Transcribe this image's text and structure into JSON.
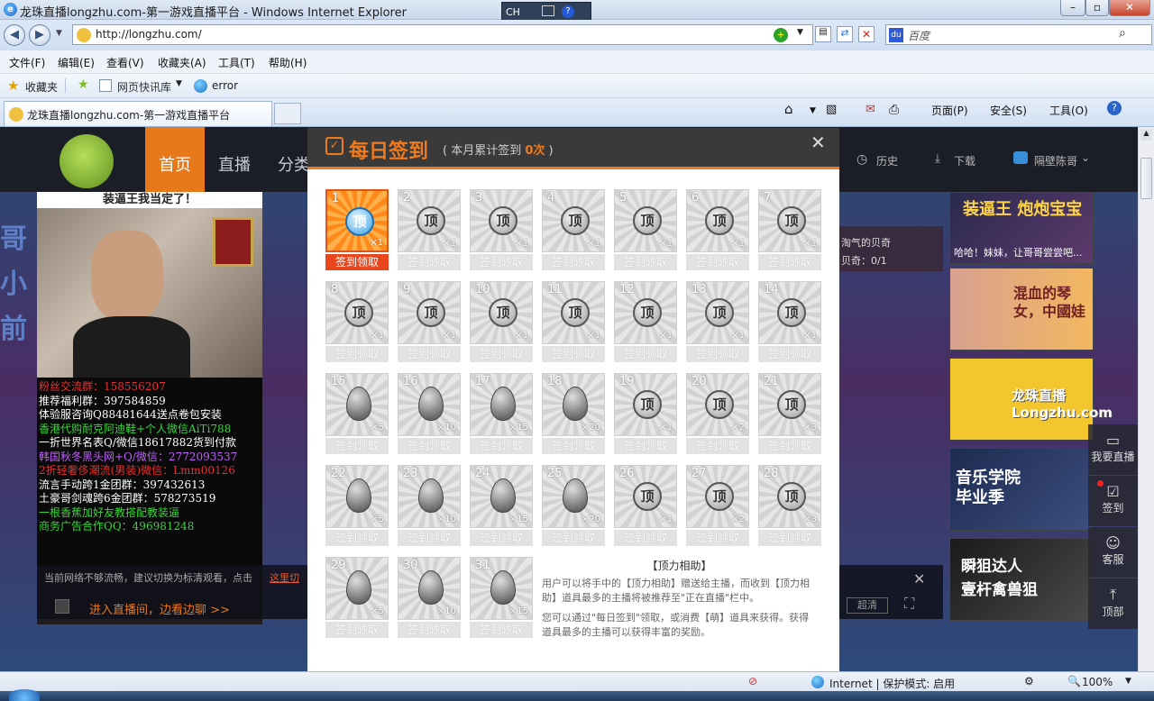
{
  "window": {
    "title": "龙珠直播longzhu.com-第一游戏直播平台 - Windows Internet Explorer",
    "lang_indicator": "CH"
  },
  "address": {
    "url": "http://longzhu.com/",
    "search_placeholder": "百度"
  },
  "menu": [
    "文件(F)",
    "编辑(E)",
    "查看(V)",
    "收藏夹(A)",
    "工具(T)",
    "帮助(H)"
  ],
  "favorites": {
    "label": "收藏夹",
    "item1": "网页快讯库",
    "item2": "error"
  },
  "tab": {
    "label": "龙珠直播longzhu.com-第一游戏直播平台"
  },
  "command_bar": {
    "page": "页面(P)",
    "safety": "安全(S)",
    "tools": "工具(O)"
  },
  "site": {
    "nav": [
      "首页",
      "直播",
      "分类"
    ],
    "history": "历史",
    "download": "下载",
    "user": "隔壁陈哥",
    "video_banner": "装逼王我当定了！",
    "chat_lines": [
      {
        "text": "粉丝交流群：158556207",
        "color": "#e83030"
      },
      {
        "text": "推荐福利群：397584859",
        "color": "#ffffff"
      },
      {
        "text": "体验服咨询Q88481644送点卷包安装",
        "color": "#ffffff"
      },
      {
        "text": "香港代购耐克阿迪鞋+个人微信AiTi788",
        "color": "#3ad43a"
      },
      {
        "text": "一折世界名表Q/微信18617882货到付款",
        "color": "#ffffff"
      },
      {
        "text": "韩国秋冬黑头网+Q/微信：2772093537",
        "color": "#c060ff"
      },
      {
        "text": "2折轻奢侈潮流(男装)微信：Lmm00126",
        "color": "#e83030"
      },
      {
        "text": "流言手动跨1金团群：397432613",
        "color": "#ffffff"
      },
      {
        "text": "土豪哥剑魂跨6金团群：578273519",
        "color": "#ffffff"
      },
      {
        "text": "一根香蕉加好友教搭配教装逼",
        "color": "#3ad43a"
      },
      {
        "text": "商务广告合作QQ：496981248",
        "color": "#3ad43a"
      }
    ],
    "network_tip": "当前网络不够流畅，建议切换为标清观看，点击",
    "network_link": "这里切",
    "enter_room": "进入直播间，边看边聊 >>",
    "clear_btn": "超清",
    "quest_text": "淘气的贝奇",
    "quest_progress": "贝奇：0/1",
    "side_buttons": [
      "我要直播",
      "签到",
      "客服",
      "顶部"
    ],
    "promos": [
      {
        "title": "装逼王 炮炮宝宝",
        "caption": "哈哈！妹妹，让哥哥尝尝吧..."
      },
      {
        "title": "混血的琴女，中國娃",
        "caption": ""
      },
      {
        "title": "龙珠直播 Longzhu.com",
        "caption": ""
      },
      {
        "title": "音乐学院毕业季",
        "caption": ""
      },
      {
        "title": "瞬狙达人 壹杆禽兽狙",
        "caption": ""
      }
    ]
  },
  "modal": {
    "title": "每日签到",
    "sub_prefix": "( 本月累计签到 ",
    "sub_count": "0次",
    "sub_suffix": " )",
    "claim_label": "签到领取",
    "days": [
      {
        "n": "1",
        "type": "ding",
        "qty": "×1"
      },
      {
        "n": "2",
        "type": "ding",
        "qty": "×1"
      },
      {
        "n": "3",
        "type": "ding",
        "qty": "×1"
      },
      {
        "n": "4",
        "type": "ding",
        "qty": "×1"
      },
      {
        "n": "5",
        "type": "ding",
        "qty": "×1"
      },
      {
        "n": "6",
        "type": "ding",
        "qty": "×1"
      },
      {
        "n": "7",
        "type": "ding",
        "qty": "×1"
      },
      {
        "n": "8",
        "type": "ding",
        "qty": "×1"
      },
      {
        "n": "9",
        "type": "ding",
        "qty": "×1"
      },
      {
        "n": "10",
        "type": "ding",
        "qty": "×1"
      },
      {
        "n": "11",
        "type": "ding",
        "qty": "×1"
      },
      {
        "n": "12",
        "type": "ding",
        "qty": "×1"
      },
      {
        "n": "13",
        "type": "ding",
        "qty": "×1"
      },
      {
        "n": "14",
        "type": "ding",
        "qty": "×1"
      },
      {
        "n": "15",
        "type": "egg",
        "qty": "×5"
      },
      {
        "n": "16",
        "type": "egg",
        "qty": "×10"
      },
      {
        "n": "17",
        "type": "egg",
        "qty": "×15"
      },
      {
        "n": "18",
        "type": "egg",
        "qty": "×20"
      },
      {
        "n": "19",
        "type": "ding",
        "qty": "×1"
      },
      {
        "n": "20",
        "type": "ding",
        "qty": "×2"
      },
      {
        "n": "21",
        "type": "ding",
        "qty": "×3"
      },
      {
        "n": "22",
        "type": "egg",
        "qty": "×5"
      },
      {
        "n": "23",
        "type": "egg",
        "qty": "×10"
      },
      {
        "n": "24",
        "type": "egg",
        "qty": "×15"
      },
      {
        "n": "25",
        "type": "egg",
        "qty": "×20"
      },
      {
        "n": "26",
        "type": "ding",
        "qty": "×1"
      },
      {
        "n": "27",
        "type": "ding",
        "qty": "×2"
      },
      {
        "n": "28",
        "type": "ding",
        "qty": "×3"
      },
      {
        "n": "29",
        "type": "egg",
        "qty": "×5"
      },
      {
        "n": "30",
        "type": "egg",
        "qty": "×10"
      },
      {
        "n": "31",
        "type": "egg",
        "qty": "×15"
      }
    ],
    "badge_char": "顶",
    "info_title": "【顶力相助】",
    "info_p1": "用户可以将手中的【顶力相助】赠送给主播，而收到【顶力相助】道具最多的主播将被推荐至\"正在直播\"栏中。",
    "info_p2": "您可以通过\"每日签到\"领取，或消费【萌】道具来获得。获得道具最多的主播可以获得丰富的奖励。"
  },
  "status": {
    "zone": "Internet | 保护模式: 启用",
    "zoom": "100%"
  }
}
